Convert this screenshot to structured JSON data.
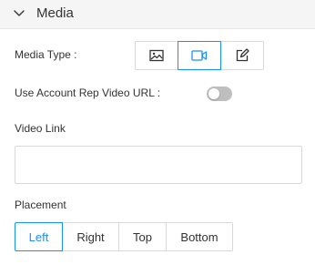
{
  "section": {
    "title": "Media",
    "collapse_icon": "chevron-down-icon"
  },
  "media_type": {
    "label": "Media Type :",
    "options": [
      {
        "name": "image",
        "icon": "image-icon",
        "selected": false
      },
      {
        "name": "video",
        "icon": "video-icon",
        "selected": true
      },
      {
        "name": "edit",
        "icon": "edit-icon",
        "selected": false
      }
    ]
  },
  "account_rep_video": {
    "label": "Use Account Rep Video URL :",
    "enabled": false
  },
  "video_link": {
    "label": "Video Link",
    "value": "",
    "placeholder": ""
  },
  "placement": {
    "label": "Placement",
    "options": [
      "Left",
      "Right",
      "Top",
      "Bottom"
    ],
    "selected": "Left"
  },
  "colors": {
    "accent": "#1890ff",
    "border": "#d9d9d9",
    "header_bg": "#f5f5f5",
    "toggle_off": "#bfbfbf"
  }
}
